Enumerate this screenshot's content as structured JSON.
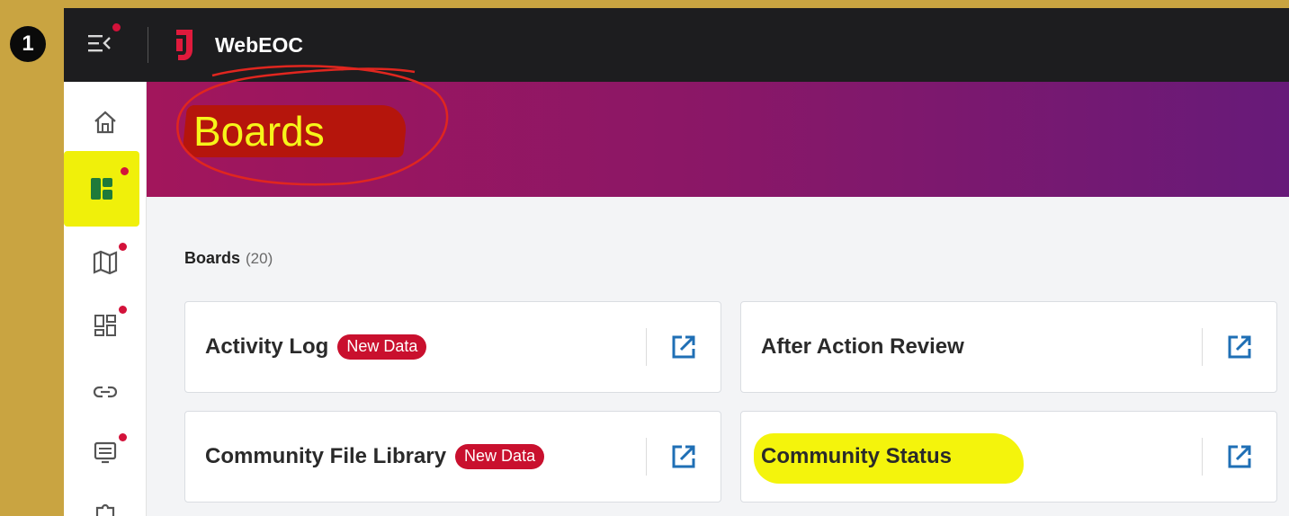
{
  "step": {
    "number": "1"
  },
  "header": {
    "app_title": "WebEOC",
    "menu_icon": "menu-collapse-icon",
    "logo": "juvare-logo"
  },
  "sidebar": {
    "items": [
      {
        "icon": "home-icon",
        "notification": false
      },
      {
        "icon": "boards-icon",
        "notification": true,
        "active": true
      },
      {
        "icon": "map-icon",
        "notification": true
      },
      {
        "icon": "dashboard-icon",
        "notification": true
      },
      {
        "icon": "link-icon",
        "notification": false
      },
      {
        "icon": "display-icon",
        "notification": true
      },
      {
        "icon": "plugin-icon",
        "notification": false
      }
    ]
  },
  "banner": {
    "title": "Boards"
  },
  "boards": {
    "label": "Boards",
    "count": "(20)",
    "items": [
      {
        "name": "Activity Log",
        "badge": "New Data"
      },
      {
        "name": "After Action Review",
        "badge": ""
      },
      {
        "name": "Community File Library",
        "badge": "New Data"
      },
      {
        "name": "Community Status",
        "badge": ""
      }
    ]
  },
  "colors": {
    "accent": "#d3123a",
    "banner_start": "#a2165c",
    "banner_end": "#671a79",
    "open_icon": "#1f6fb5",
    "highlight": "#f4f40c"
  }
}
